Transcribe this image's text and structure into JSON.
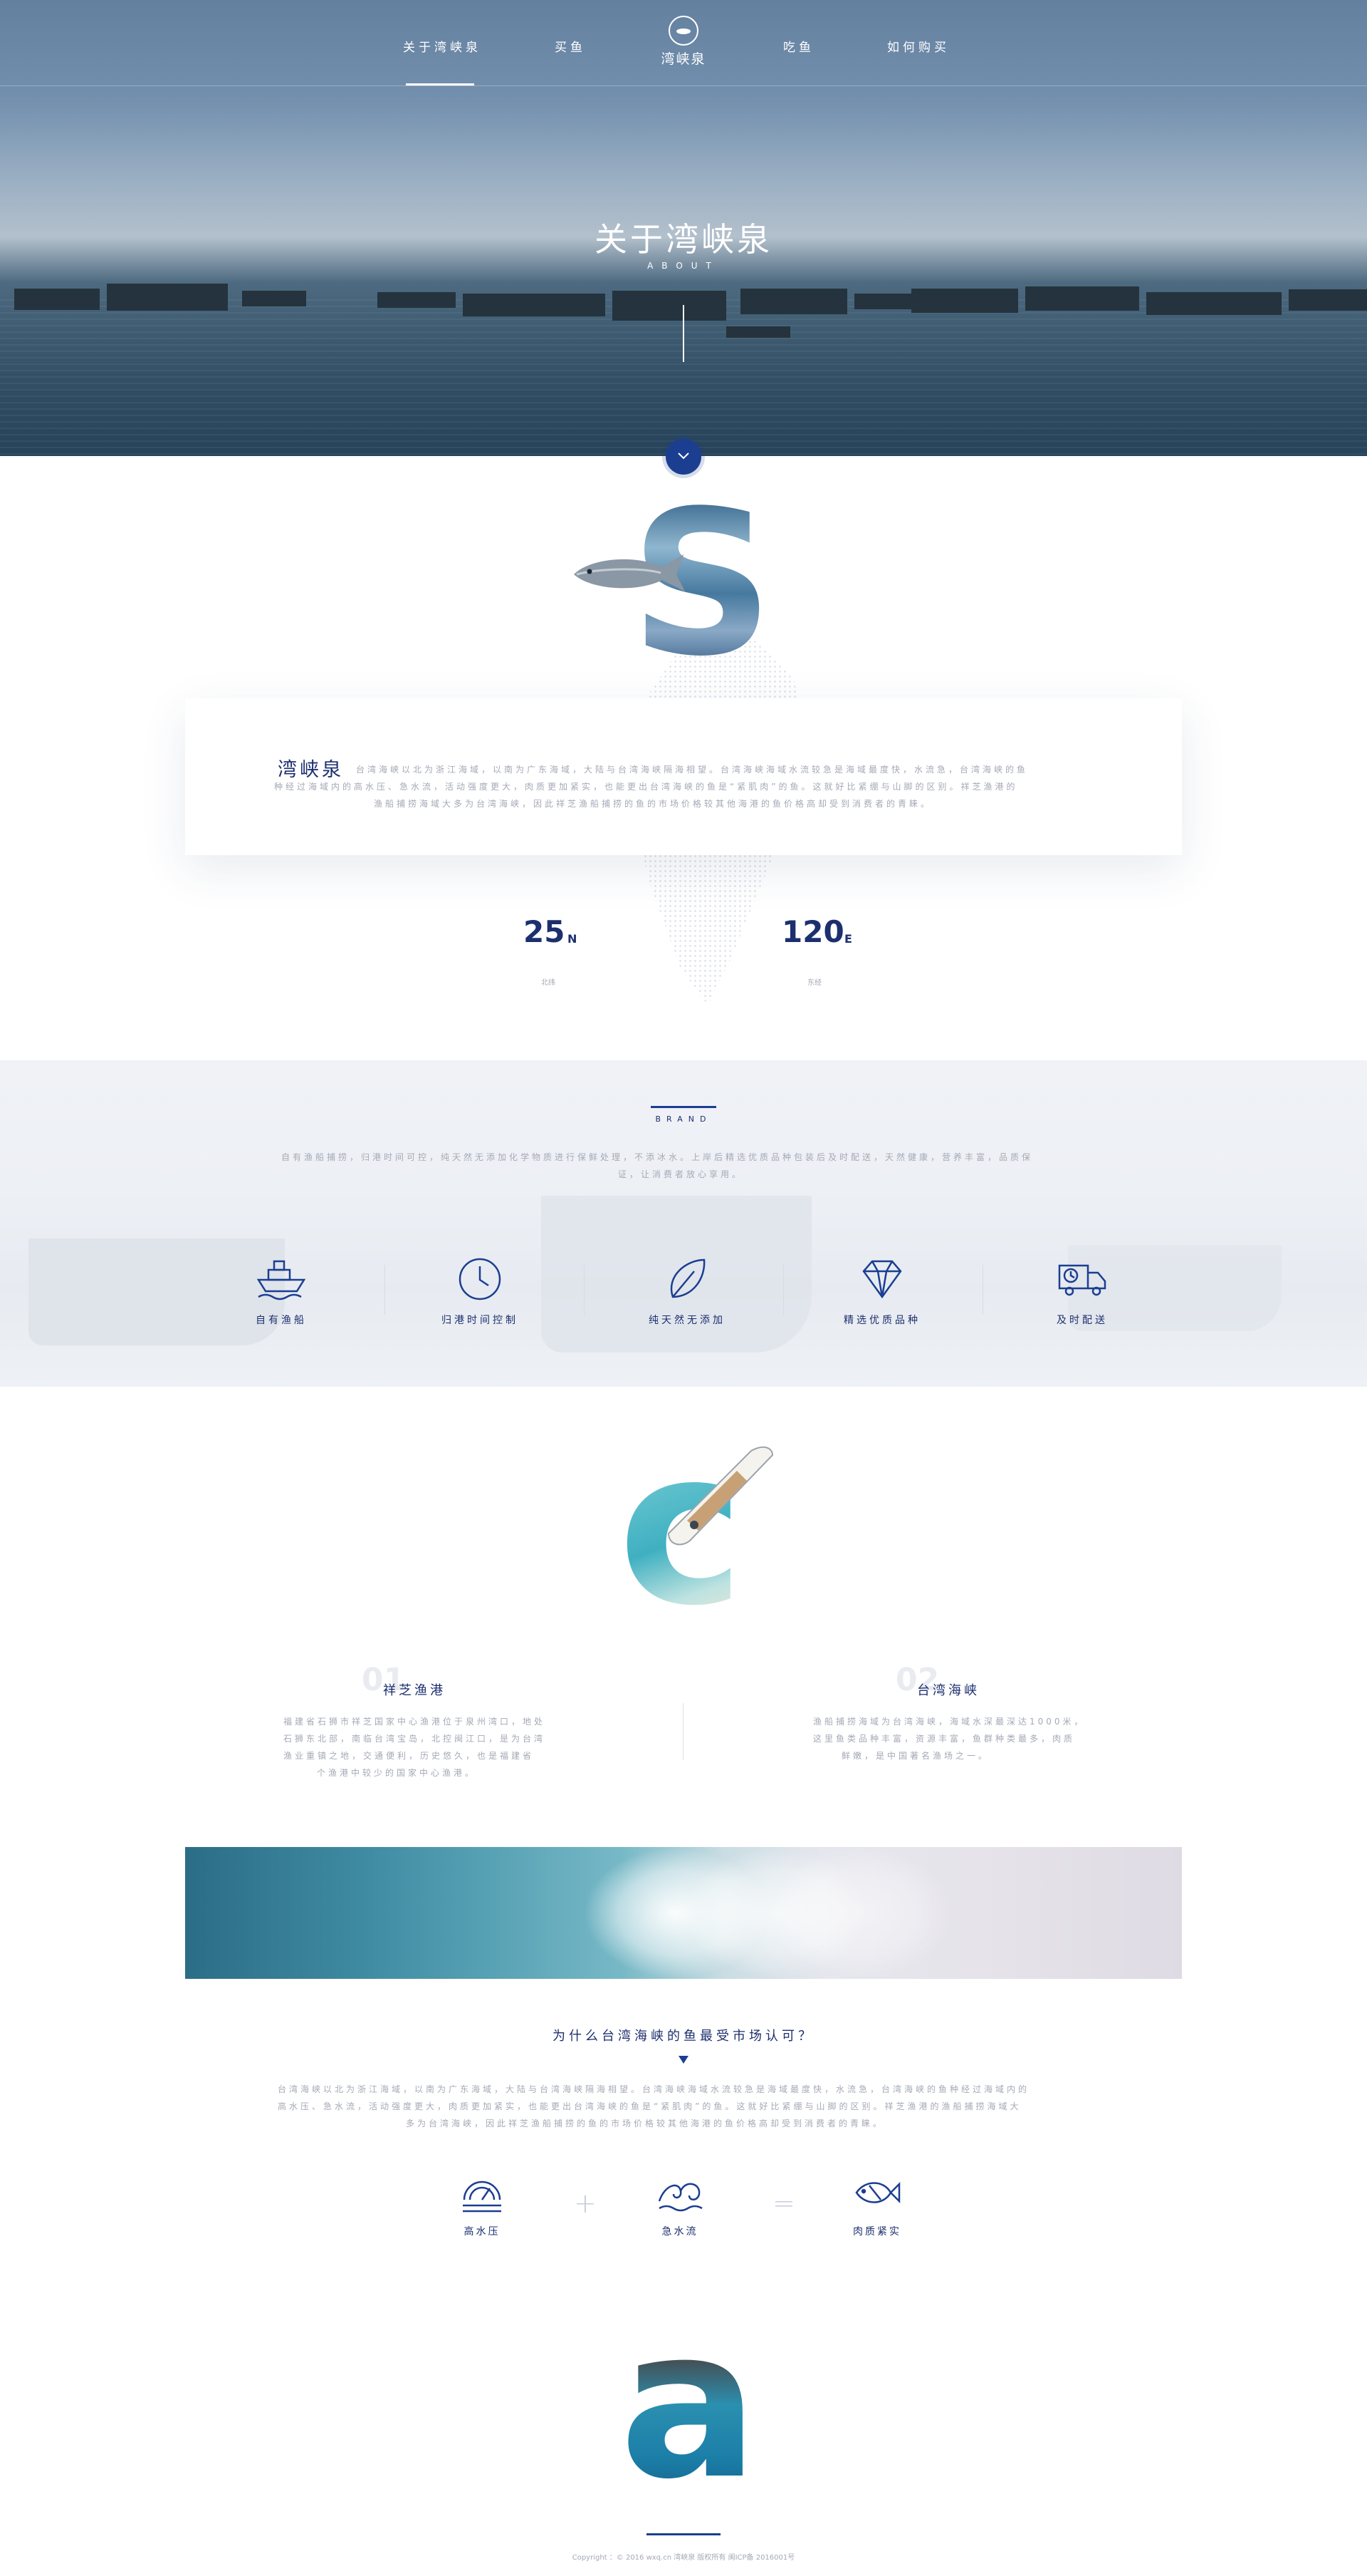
{
  "nav": {
    "items": [
      "关于湾峡泉",
      "买鱼",
      "吃鱼",
      "如何购买"
    ],
    "active": "关于湾峡泉",
    "logo_text": "湾峡泉"
  },
  "hero": {
    "title": "关于湾峡泉",
    "subtitle": "ABOUT"
  },
  "intro": {
    "letter": "S",
    "brand_name": "湾峡泉",
    "text_line1": "台湾海峡以北为浙江海域，以南为广东海域，大陆与台湾海峡隔海相望。台湾海峡海域水流较急是海域最度快，水流急，台湾海峡的鱼",
    "text_line2": "种经过海域内的高水压、急水流，活动强度更大，肉质更加紧实，也能更出台湾海峡的鱼是“紧肌肉”的鱼。这就好比紧绷与山脚的区别。祥芝渔港的",
    "text_line3": "渔船捕捞海域大多为台湾海峡，因此祥芝渔船捕捞的鱼的市场价格较其他海港的鱼价格高却受到消费者的青睐。",
    "stats": [
      {
        "value": "25",
        "unit": "N",
        "caption": "北纬"
      },
      {
        "value": "120",
        "unit": "E",
        "caption": "东经"
      }
    ]
  },
  "brand": {
    "title": "BRAND",
    "text_line1": "自有渔船捕捞，归港时间可控，纯天然无添加化学物质进行保鲜处理，不添冰水。上岸后精选优质品种包装后及时配送，天然健康，营养丰富，品质保",
    "text_line2": "证，让消费者放心享用。",
    "features": [
      {
        "icon": "fishing-boat-icon",
        "label": "自有渔船"
      },
      {
        "icon": "clock-icon",
        "label": "归港时间控制"
      },
      {
        "icon": "leaf-icon",
        "label": "纯天然无添加"
      },
      {
        "icon": "diamond-icon",
        "label": "精选优质品种"
      },
      {
        "icon": "delivery-truck-icon",
        "label": "及时配送"
      }
    ]
  },
  "origin": {
    "letter": "c",
    "columns": [
      {
        "num": "01",
        "title": "祥芝渔港",
        "lines": [
          "福建省石狮市祥芝国家中心渔港位于泉州湾口，地处",
          "石狮东北部，南临台湾宝岛，北控闽江口，是为台湾",
          "渔业重镇之地，交通便利，历史悠久，也是福建省",
          "个渔港中较少的国家中心渔港。"
        ]
      },
      {
        "num": "02",
        "title": "台湾海峡",
        "lines": [
          "渔船捕捞海域为台湾海峡，海域水深最深达1000米，",
          "这里鱼类品种丰富，资源丰富，鱼群种类最多，肉质",
          "鲜嫩，是中国著名渔场之一。"
        ]
      }
    ]
  },
  "why": {
    "title": "为什么台湾海峡的鱼最受市场认可？",
    "text_line1": "台湾海峡以北为浙江海域，以南为广东海域，大陆与台湾海峡隔海相望。台湾海峡海域水流较急是海域最度快，水流急，台湾海峡的鱼种经过海域内的",
    "text_line2": "高水压、急水流，活动强度更大，肉质更加紧实，也能更出台湾海峡的鱼是“紧肌肉”的鱼。这就好比紧绷与山脚的区别。祥芝渔港的渔船捕捞海域大",
    "text_line3": "多为台湾海峡，因此祥芝渔船捕捞的鱼的市场价格较其他海港的鱼价格高却受到消费者的青睐。",
    "factors": [
      {
        "icon": "pressure-gauge-icon",
        "label": "高水压"
      },
      {
        "icon": "water-current-icon",
        "label": "急水流"
      },
      {
        "icon": "fish-icon",
        "label": "肉质紧实"
      }
    ],
    "plus": "+",
    "equals": "="
  },
  "footer": {
    "letter": "a",
    "copyright": "Copyright ：© 2016 wxq.cn 湾峡泉 版权所有 闽ICP备 2016001号"
  },
  "colors": {
    "primary": "#1b3e91",
    "text_navy": "#1c2f6e",
    "muted": "#a4a9b6",
    "brand_bg": "#eef1f5"
  }
}
